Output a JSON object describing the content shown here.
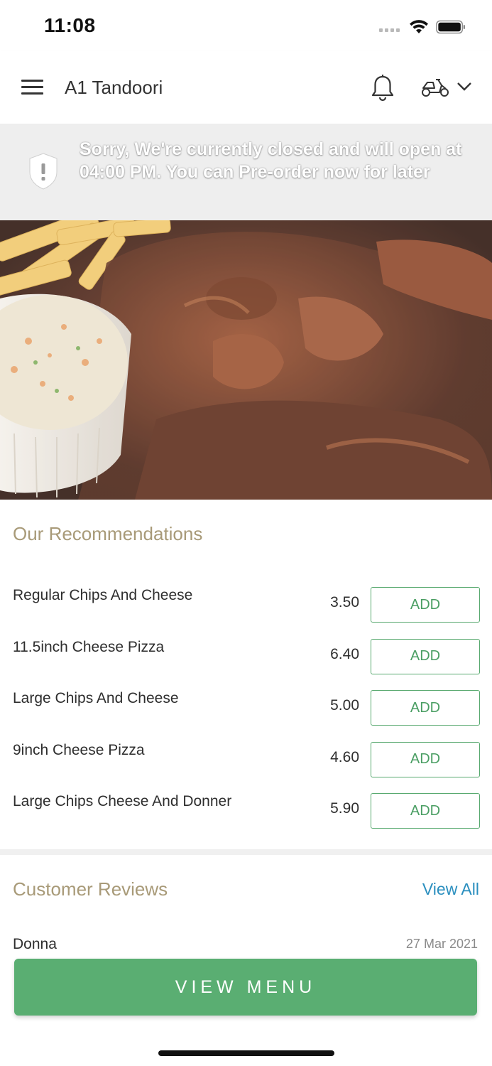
{
  "status_bar": {
    "time": "11:08",
    "icons": [
      "cellular-signal-icon",
      "wifi-icon",
      "battery-icon"
    ]
  },
  "header": {
    "title": "A1 Tandoori",
    "icons": [
      "menu-icon",
      "bell-icon",
      "scooter-delivery-icon",
      "chevron-down-icon"
    ]
  },
  "banner": {
    "message": "Sorry, We're currently closed and will open at 04:00 PM. You can Pre-order now for later",
    "icon": "shield-alert-icon"
  },
  "recommendations": {
    "title": "Our Recommendations",
    "items": [
      {
        "name": "Regular Chips And Cheese",
        "price": "3.50",
        "button": "ADD"
      },
      {
        "name": "11.5inch Cheese Pizza",
        "price": "6.40",
        "button": "ADD"
      },
      {
        "name": "Large Chips And Cheese",
        "price": "5.00",
        "button": "ADD"
      },
      {
        "name": "9inch Cheese Pizza",
        "price": "4.60",
        "button": "ADD"
      },
      {
        "name": "Large Chips Cheese And Donner",
        "price": "5.90",
        "button": "ADD"
      }
    ]
  },
  "reviews": {
    "title": "Customer Reviews",
    "view_all": "View All",
    "first_review": {
      "author": "Donna",
      "date": "27 Mar 2021"
    }
  },
  "footer": {
    "view_menu": "VIEW MENU"
  },
  "colors": {
    "accent_green": "#5aae72",
    "section_title": "#a89a78",
    "link_blue": "#2b8fbf",
    "banner_bg": "#eeeeee"
  }
}
